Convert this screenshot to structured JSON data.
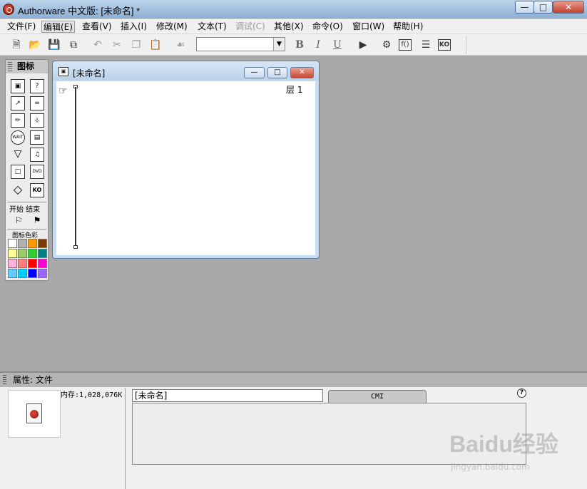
{
  "window": {
    "title": "Authorware 中文版: [未命名] *",
    "minimize": "—",
    "maximize": "□",
    "close": "✕"
  },
  "menu": [
    {
      "label": "文件(F)",
      "state": "normal"
    },
    {
      "label": "编辑(E)",
      "state": "active"
    },
    {
      "label": "查看(V)",
      "state": "normal"
    },
    {
      "label": "插入(I)",
      "state": "normal"
    },
    {
      "label": "修改(M)",
      "state": "normal"
    },
    {
      "label": "文本(T)",
      "state": "normal"
    },
    {
      "label": "调试(C)",
      "state": "disabled"
    },
    {
      "label": "其他(X)",
      "state": "normal"
    },
    {
      "label": "命令(O)",
      "state": "normal"
    },
    {
      "label": "窗口(W)",
      "state": "normal"
    },
    {
      "label": "帮助(H)",
      "state": "normal"
    }
  ],
  "toolbar": {
    "bold": "B",
    "italic": "I",
    "underline": "U",
    "font_value": ""
  },
  "palette": {
    "title": "图标",
    "start_end_label": "开始 结束",
    "colors_label": "图标色彩",
    "wait_label": "WAIT",
    "dvd_label": "DVD",
    "ko_label": "KO",
    "swatches": [
      "#ffffff",
      "#b0b0b0",
      "#ff9900",
      "#7a3b00",
      "#ffff99",
      "#99cc66",
      "#33cc33",
      "#008080",
      "#ffb3d9",
      "#ff8080",
      "#ff0000",
      "#ff00cc",
      "#66ccff",
      "#00ccff",
      "#0000ff",
      "#9966ff"
    ]
  },
  "design_window": {
    "title": "[未命名]",
    "layer_label": "层 1"
  },
  "properties": {
    "header": "属性: 文件",
    "memory": "内存:1,028,076K",
    "name_value": "[未命名]",
    "tab_cmi": "CMI",
    "help": "?"
  },
  "watermark": {
    "logo": "Baidu经验",
    "url": "jingyan.baidu.com"
  }
}
